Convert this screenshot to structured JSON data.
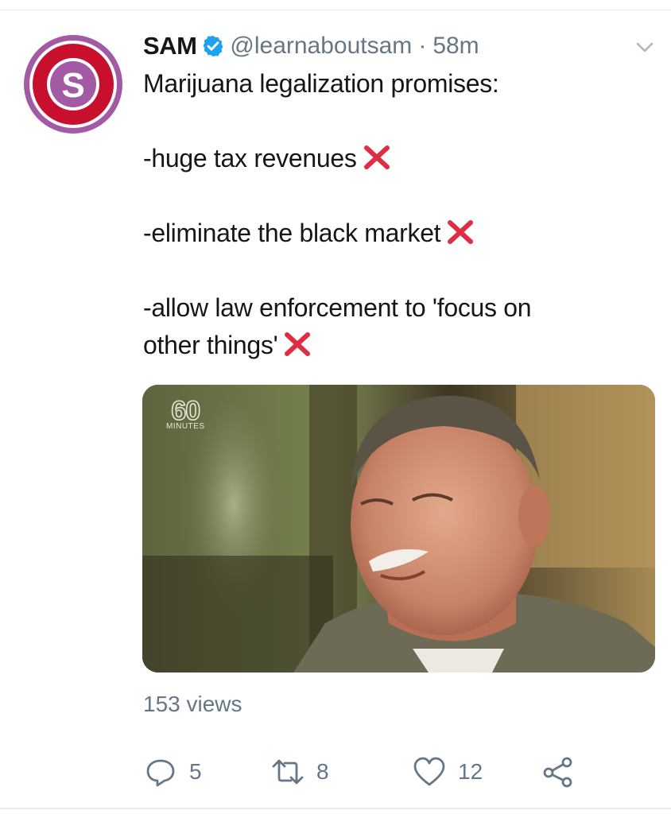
{
  "tweet": {
    "author_name": "SAM",
    "handle": "@learnaboutsam",
    "separator": "·",
    "time_ago": "58m",
    "avatar_letter": "S",
    "verified": true,
    "text_lines": [
      "Marijuana legalization promises:",
      "-huge tax revenues",
      "-eliminate the black market",
      "-allow law enforcement to 'focus on",
      "other things'"
    ],
    "media": {
      "logo_number": "60",
      "logo_sub": "MINUTES"
    },
    "views": "153 views",
    "actions": {
      "reply_count": "5",
      "retweet_count": "8",
      "like_count": "12"
    }
  },
  "colors": {
    "avatar_ring": "#a35aa5",
    "avatar_fill": "#c8102e",
    "verified_blue": "#1da1f2",
    "x_mark_red": "#dd2e44",
    "secondary_text": "#657786"
  },
  "icons": {
    "verified": "verified-badge-icon",
    "menu": "chevron-down-icon",
    "x_mark": "cross-mark-emoji",
    "reply": "reply-icon",
    "retweet": "retweet-icon",
    "like": "heart-icon",
    "share": "share-icon"
  }
}
